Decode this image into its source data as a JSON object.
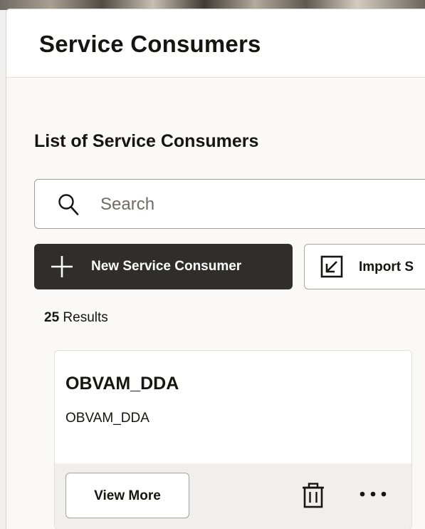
{
  "page": {
    "title": "Service Consumers",
    "section_title": "List of Service Consumers"
  },
  "search": {
    "placeholder": "Search",
    "value": "",
    "icon": "search-icon"
  },
  "toolbar": {
    "new_label": "New Service Consumer",
    "new_icon": "plus-icon",
    "import_label": "Import S",
    "import_icon": "import-arrow-icon"
  },
  "results": {
    "count": "25",
    "label": " Results"
  },
  "cards": [
    {
      "title": "OBVAM_DDA",
      "subtitle": "OBVAM_DDA",
      "view_more_label": "View More",
      "delete_icon": "trash-icon",
      "more_icon": "more-options-icon"
    }
  ],
  "colors": {
    "primary_button": "#312d2a",
    "page_background": "#f1efed",
    "panel_background": "#fbf9f8",
    "card_footer": "#f1efed",
    "text": "#161513"
  }
}
